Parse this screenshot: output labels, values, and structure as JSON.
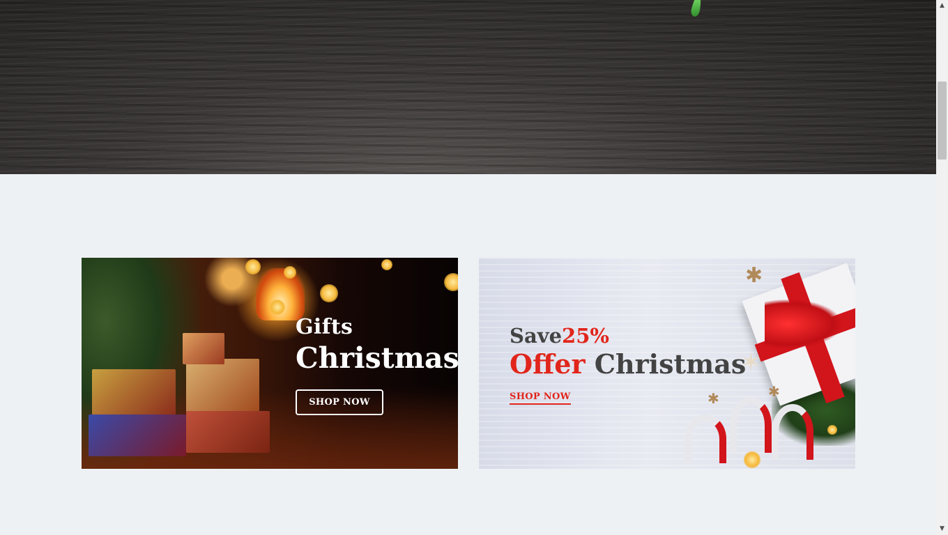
{
  "banners": {
    "left": {
      "title_small": "Gifts",
      "title_big": "Christmas",
      "button_label": "SHOP NOW"
    },
    "right": {
      "save_text": "Save",
      "save_percent": "25%",
      "offer_word": "Offer",
      "offer_rest": "Christmas",
      "link_label": "SHOP NOW"
    }
  },
  "scrollbar": {
    "up_icon": "▲",
    "down_icon": "▼"
  },
  "colors": {
    "accent_red": "#e1251b",
    "text_dark": "#434343",
    "page_bg": "#eef1f4"
  }
}
